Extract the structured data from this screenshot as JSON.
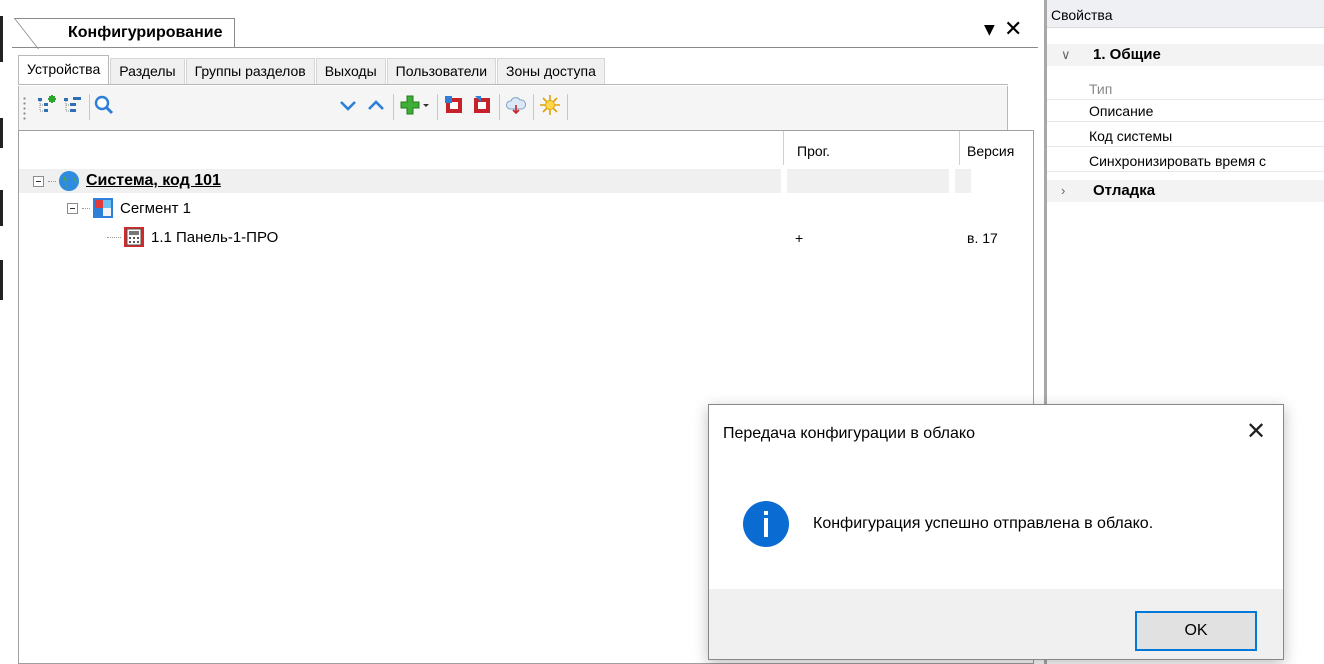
{
  "panel": {
    "title": "Конфигурирование",
    "tabs": [
      "Устройства",
      "Разделы",
      "Группы разделов",
      "Выходы",
      "Пользователи",
      "Зоны доступа"
    ],
    "active_tab": "Устройства"
  },
  "toolbar": {
    "icons": [
      "add-child-icon",
      "add-sibling-icon",
      "search-icon",
      "move-down-icon",
      "move-up-icon",
      "add-dropdown-icon",
      "read-config-icon",
      "write-config-icon",
      "cloud-icon",
      "new-icon"
    ]
  },
  "tree": {
    "columns": {
      "prog": "Прог.",
      "version": "Версия"
    },
    "rows": [
      {
        "label": "Система, код 101",
        "prog": "",
        "version": ""
      },
      {
        "label": "Сегмент 1",
        "prog": "",
        "version": ""
      },
      {
        "label": "1.1 Панель-1-ПРО",
        "prog": "+",
        "version": "в. 17"
      }
    ]
  },
  "properties": {
    "title": "Свойства",
    "groups": [
      {
        "label": "1. Общие",
        "expanded": true,
        "items": [
          "Тип",
          "Описание",
          "Код системы",
          "Синхронизировать время с"
        ]
      },
      {
        "label": "Отладка",
        "expanded": false,
        "items": []
      }
    ]
  },
  "dialog": {
    "title": "Передача конфигурации в облако",
    "message": "Конфигурация успешно отправлена в облако.",
    "ok_label": "OK"
  },
  "colors": {
    "accent": "#0078d7",
    "info": "#0a6cd3"
  }
}
